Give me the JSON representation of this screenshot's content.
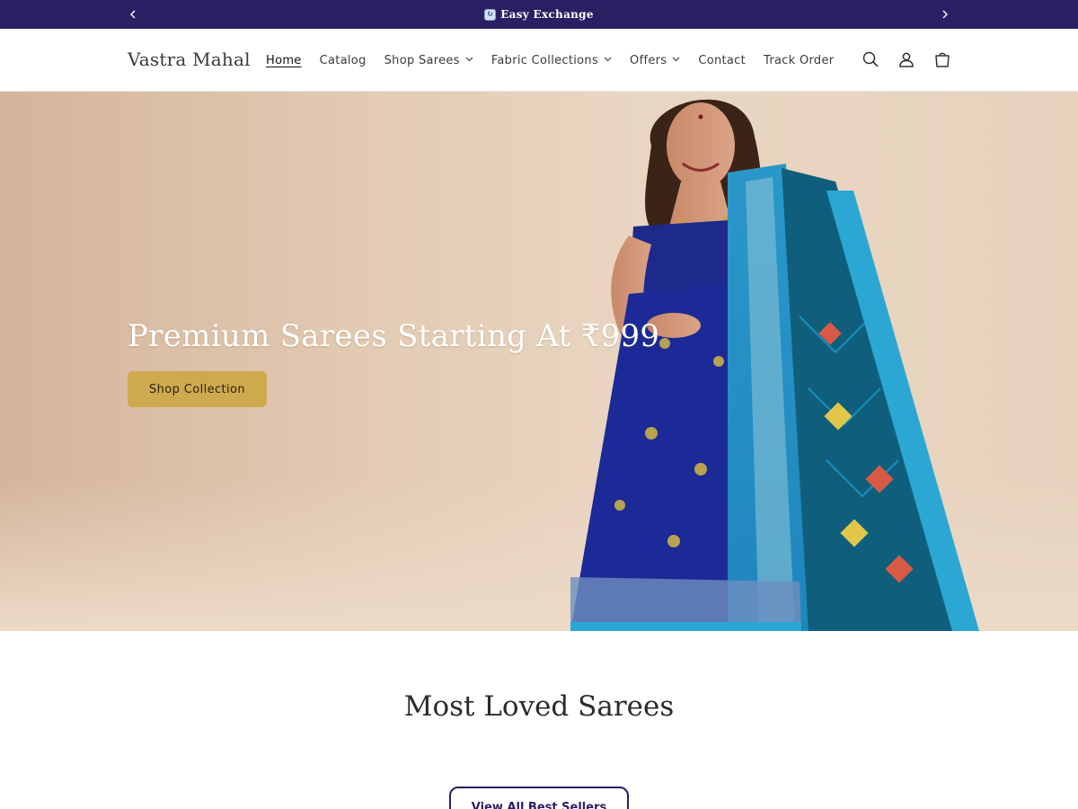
{
  "announcement": {
    "prev_icon": "chevron-left-icon",
    "next_icon": "chevron-right-icon",
    "icon": "exchange-icon",
    "text": "Easy Exchange"
  },
  "header": {
    "logo": "Vastra Mahal",
    "nav": [
      {
        "label": "Home",
        "active": true,
        "dropdown": false
      },
      {
        "label": "Catalog",
        "active": false,
        "dropdown": false
      },
      {
        "label": "Shop Sarees",
        "active": false,
        "dropdown": true
      },
      {
        "label": "Fabric Collections",
        "active": false,
        "dropdown": true
      },
      {
        "label": "Offers",
        "active": false,
        "dropdown": true
      },
      {
        "label": "Contact",
        "active": false,
        "dropdown": false
      },
      {
        "label": "Track Order",
        "active": false,
        "dropdown": false
      }
    ],
    "icons": [
      "search-icon",
      "account-icon",
      "cart-icon"
    ]
  },
  "hero": {
    "title": "Premium Sarees Starting At ₹999",
    "button_label": "Shop Collection"
  },
  "best_sellers": {
    "title": "Most Loved Sarees",
    "button_label": "View All Best Sellers"
  },
  "colors": {
    "announcement_bg": "#2a1f63",
    "accent_gold": "#cfa94d",
    "primary_indigo": "#2a1f63"
  }
}
